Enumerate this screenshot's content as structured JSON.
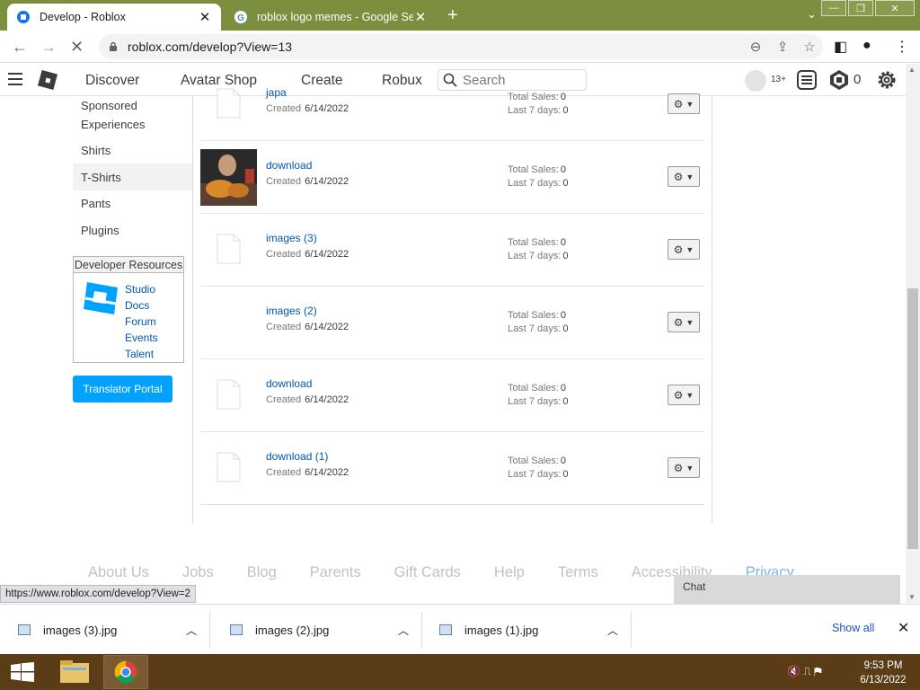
{
  "browser": {
    "active_tab_title": "Develop - Roblox",
    "inactive_tab_title": "roblox logo memes - Google Sea",
    "url": "roblox.com/develop?View=13",
    "status_url": "https://www.roblox.com/develop?View=2"
  },
  "header": {
    "nav": [
      "Discover",
      "Avatar Shop",
      "Create",
      "Robux"
    ],
    "search_placeholder": "Search",
    "age_badge": "13+",
    "robux_count": "0"
  },
  "sidebar": {
    "items": [
      "Sponsored",
      "Experiences",
      "Shirts",
      "T-Shirts",
      "Pants",
      "Plugins"
    ],
    "selected": "T-Shirts",
    "dev_resources": {
      "title": "Developer Resources",
      "links": [
        "Studio",
        "Docs",
        "Forum",
        "Events",
        "Talent"
      ]
    },
    "translator_button": "Translator Portal"
  },
  "items_list": {
    "created_label": "Created",
    "total_sales_label": "Total Sales:",
    "last7_label": "Last 7 days:",
    "rows": [
      {
        "name": "japa",
        "created": "6/14/2022",
        "total_sales": "0",
        "last7": "0",
        "thumb": "file"
      },
      {
        "name": "download",
        "created": "6/14/2022",
        "total_sales": "0",
        "last7": "0",
        "thumb": "photo"
      },
      {
        "name": "images (3)",
        "created": "6/14/2022",
        "total_sales": "0",
        "last7": "0",
        "thumb": "file"
      },
      {
        "name": "images (2)",
        "created": "6/14/2022",
        "total_sales": "0",
        "last7": "0",
        "thumb": "blank"
      },
      {
        "name": "download",
        "created": "6/14/2022",
        "total_sales": "0",
        "last7": "0",
        "thumb": "file"
      },
      {
        "name": "download (1)",
        "created": "6/14/2022",
        "total_sales": "0",
        "last7": "0",
        "thumb": "file"
      }
    ]
  },
  "footer": {
    "links": [
      "About Us",
      "Jobs",
      "Blog",
      "Parents",
      "Gift Cards",
      "Help",
      "Terms",
      "Accessibility",
      "Privacy"
    ]
  },
  "chat": {
    "label": "Chat"
  },
  "downloads": {
    "items": [
      "images (3).jpg",
      "images (2).jpg",
      "images (1).jpg"
    ],
    "show_all": "Show all"
  },
  "taskbar": {
    "time": "9:53 PM",
    "date": "6/13/2022"
  },
  "colors": {
    "link": "#0055b3",
    "primary_button": "#00a2ff",
    "browser_frame": "#7b8f3e",
    "taskbar": "#5a3d16"
  }
}
